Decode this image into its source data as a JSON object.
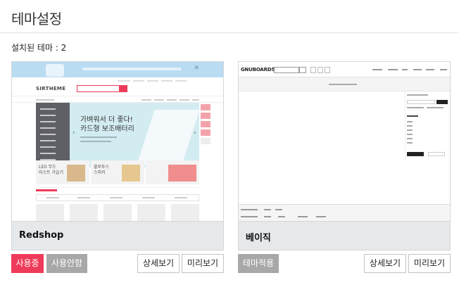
{
  "page": {
    "title": "테마설정",
    "installed_count": "설치된 테마 : 2"
  },
  "themes": [
    {
      "name": "Redshop",
      "status_label": "사용중",
      "toggle_label": "사용안함",
      "detail_label": "상세보기",
      "preview_label": "미리보기",
      "thumbnail": {
        "logo": "SIRTHEME",
        "hero_text": "가벼워서 더 좋다!\n카드형 보조배터리",
        "promo_1": "LED 무드\n미스트 가습기",
        "promo_2": "블루투스\n스피커",
        "accent": "#ef3b5a"
      }
    },
    {
      "name": "베이직",
      "apply_label": "테마적용",
      "detail_label": "상세보기",
      "preview_label": "미리보기",
      "thumbnail": {
        "logo": "GNUBOARD5",
        "accent": "#222222"
      }
    }
  ],
  "colors": {
    "active_red": "#ef3b5a",
    "inactive_gray": "#a8a8a8",
    "name_bar": "#e6e9ec"
  }
}
